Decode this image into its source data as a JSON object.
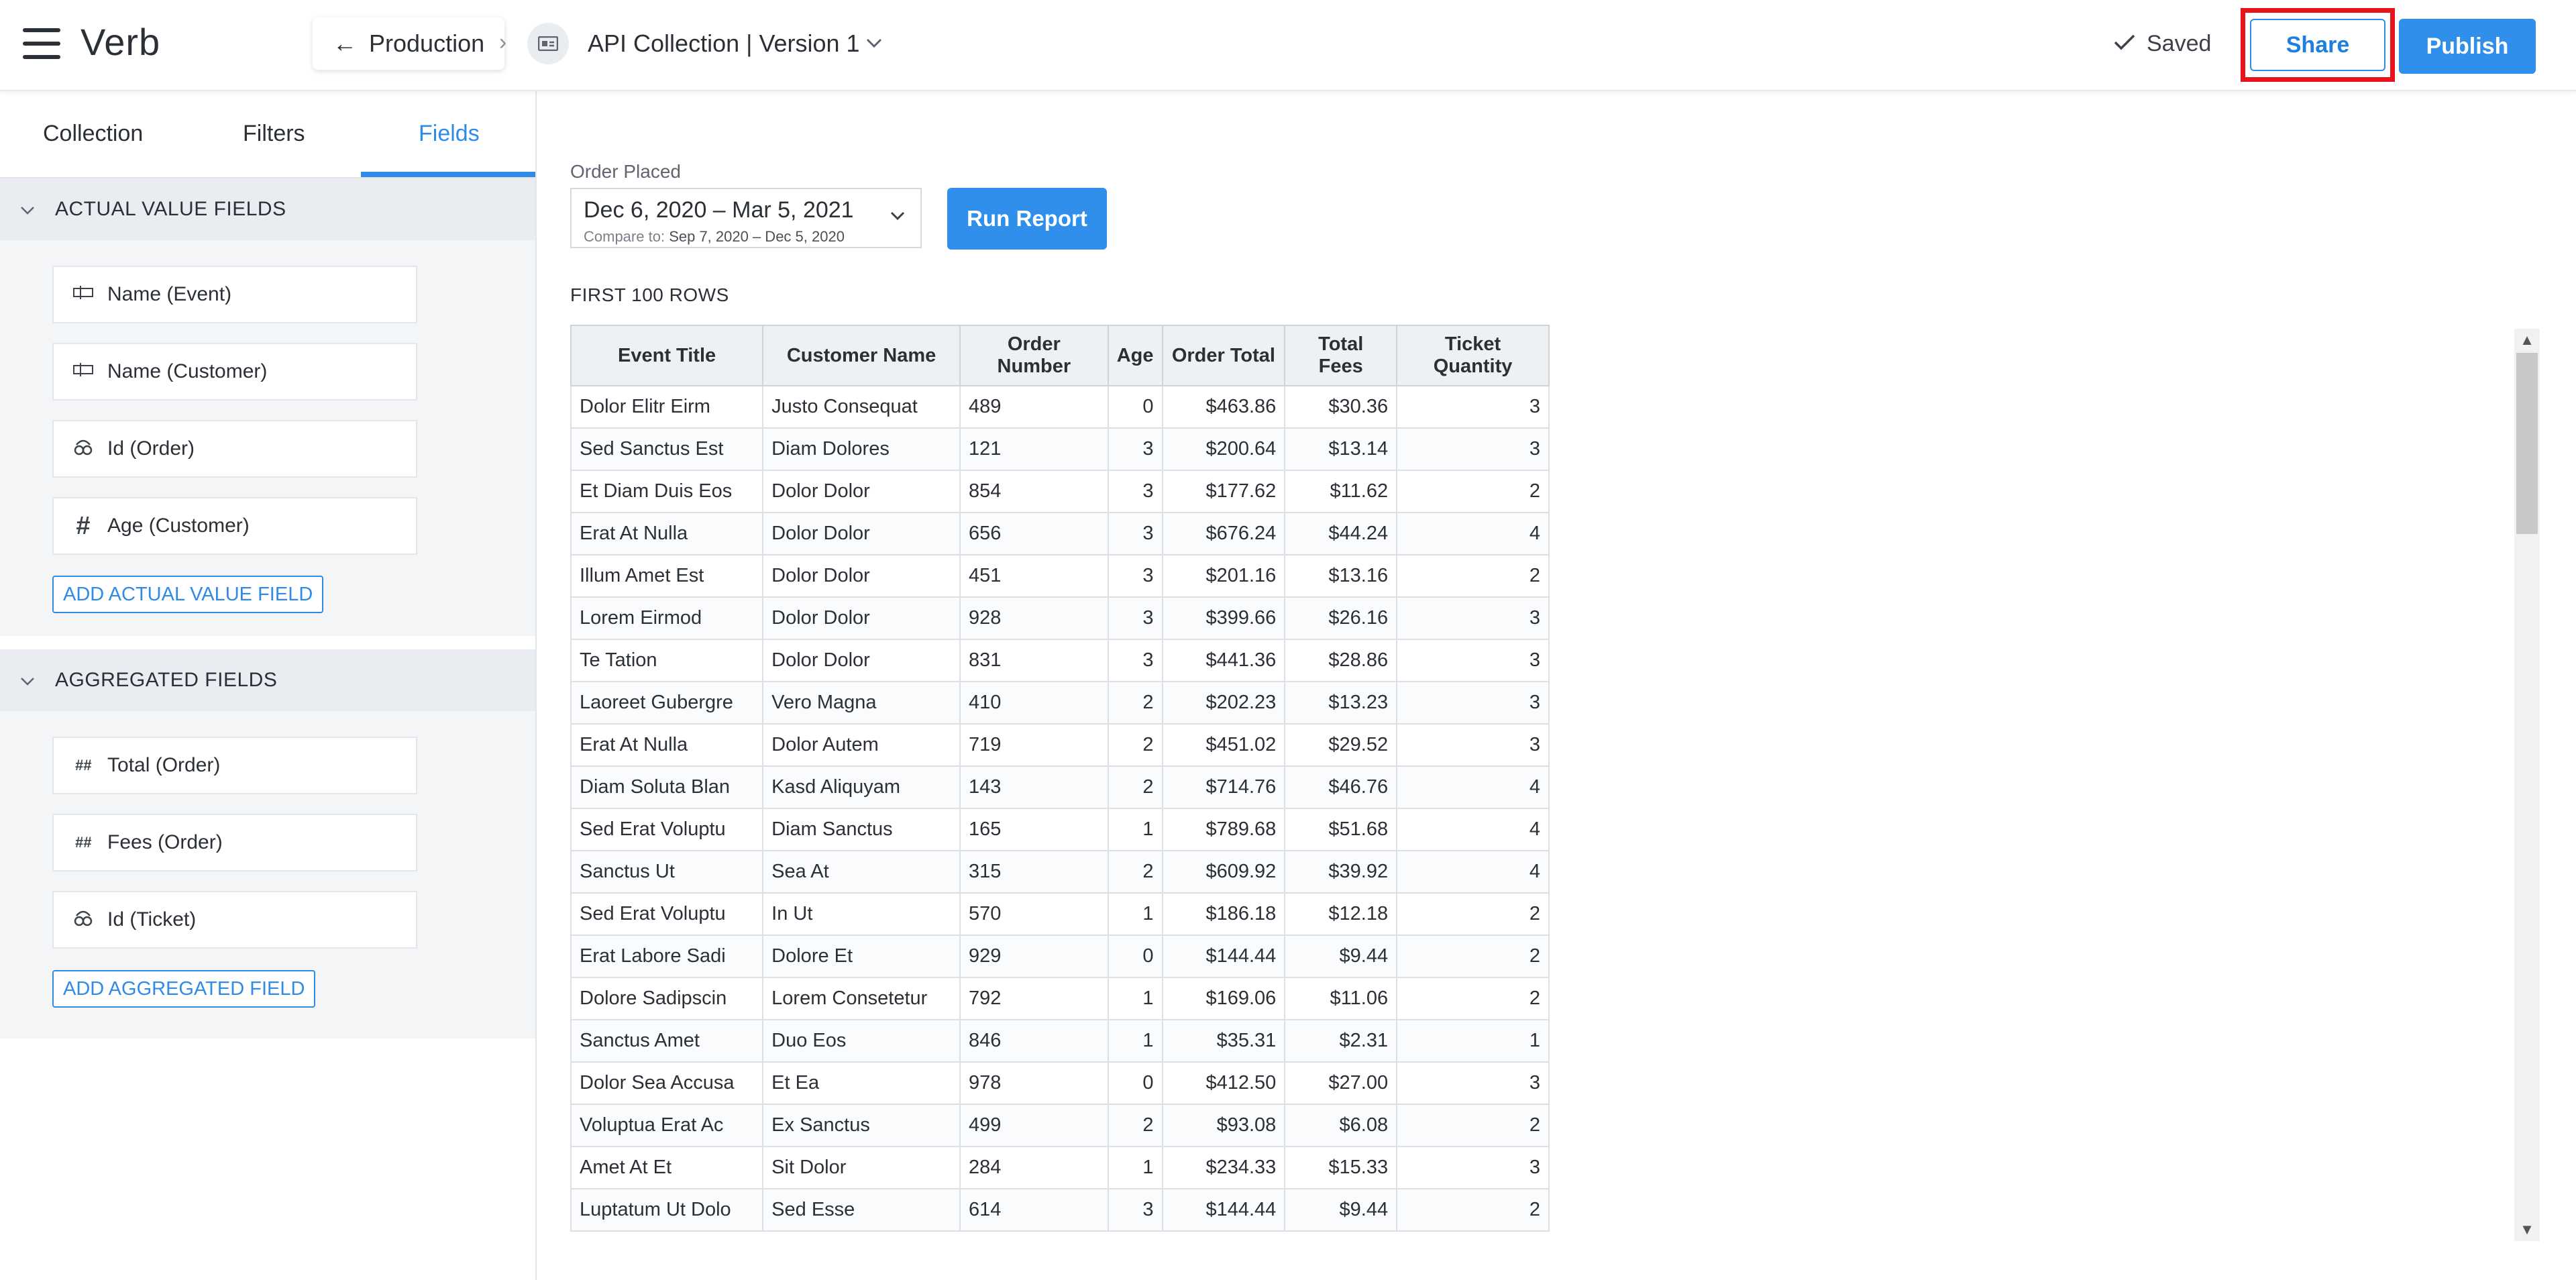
{
  "app": {
    "logo": "Verb"
  },
  "header": {
    "back_label": "Production",
    "separator": "›",
    "doc_title": "API Collection | Version 1",
    "saved_label": "Saved",
    "share_label": "Share",
    "publish_label": "Publish"
  },
  "sidebar": {
    "tabs": [
      {
        "label": "Collection"
      },
      {
        "label": "Filters"
      },
      {
        "label": "Fields",
        "active": true
      }
    ],
    "actual_section": {
      "title": "ACTUAL VALUE FIELDS",
      "fields": [
        {
          "label": "Name (Event)",
          "icon": "text-field-icon"
        },
        {
          "label": "Name (Customer)",
          "icon": "text-field-icon"
        },
        {
          "label": "Id (Order)",
          "icon": "id-icon"
        },
        {
          "label": "Age (Customer)",
          "icon": "hash-icon"
        }
      ],
      "add_label": "ADD ACTUAL VALUE FIELD"
    },
    "aggregated_section": {
      "title": "AGGREGATED FIELDS",
      "fields": [
        {
          "label": "Total (Order)",
          "icon": "sum-hash-icon"
        },
        {
          "label": "Fees (Order)",
          "icon": "sum-hash-icon"
        },
        {
          "label": "Id (Ticket)",
          "icon": "id-icon"
        }
      ],
      "add_label": "ADD AGGREGATED FIELD"
    }
  },
  "report": {
    "date_label": "Order Placed",
    "date_range": "Dec 6, 2020 – Mar 5, 2021",
    "compare_prefix": "Compare to:",
    "compare_range": "Sep 7, 2020 – Dec 5, 2020",
    "run_label": "Run Report",
    "rows_label": "FIRST 100 ROWS"
  },
  "table": {
    "headers": [
      "Event Title",
      "Customer Name",
      "Order Number",
      "Age",
      "Order Total",
      "Total Fees",
      "Ticket Quantity"
    ],
    "rows": [
      [
        "Dolor Elitr Eirm",
        "Justo Consequat",
        "489",
        "0",
        "$463.86",
        "$30.36",
        "3"
      ],
      [
        "Sed Sanctus Est",
        "Diam Dolores",
        "121",
        "3",
        "$200.64",
        "$13.14",
        "3"
      ],
      [
        "Et Diam Duis Eos",
        "Dolor Dolor",
        "854",
        "3",
        "$177.62",
        "$11.62",
        "2"
      ],
      [
        "Erat At Nulla",
        "Dolor Dolor",
        "656",
        "3",
        "$676.24",
        "$44.24",
        "4"
      ],
      [
        "Illum Amet Est",
        "Dolor Dolor",
        "451",
        "3",
        "$201.16",
        "$13.16",
        "2"
      ],
      [
        "Lorem Eirmod",
        "Dolor Dolor",
        "928",
        "3",
        "$399.66",
        "$26.16",
        "3"
      ],
      [
        "Te Tation",
        "Dolor Dolor",
        "831",
        "3",
        "$441.36",
        "$28.86",
        "3"
      ],
      [
        "Laoreet Gubergre",
        "Vero Magna",
        "410",
        "2",
        "$202.23",
        "$13.23",
        "3"
      ],
      [
        "Erat At Nulla",
        "Dolor Autem",
        "719",
        "2",
        "$451.02",
        "$29.52",
        "3"
      ],
      [
        "Diam Soluta Blan",
        "Kasd Aliquyam",
        "143",
        "2",
        "$714.76",
        "$46.76",
        "4"
      ],
      [
        "Sed Erat Voluptu",
        "Diam Sanctus",
        "165",
        "1",
        "$789.68",
        "$51.68",
        "4"
      ],
      [
        "Sanctus Ut",
        "Sea At",
        "315",
        "2",
        "$609.92",
        "$39.92",
        "4"
      ],
      [
        "Sed Erat Voluptu",
        "In Ut",
        "570",
        "1",
        "$186.18",
        "$12.18",
        "2"
      ],
      [
        "Erat Labore Sadi",
        "Dolore Et",
        "929",
        "0",
        "$144.44",
        "$9.44",
        "2"
      ],
      [
        "Dolore Sadipscin",
        "Lorem Consetetur",
        "792",
        "1",
        "$169.06",
        "$11.06",
        "2"
      ],
      [
        "Sanctus Amet",
        "Duo Eos",
        "846",
        "1",
        "$35.31",
        "$2.31",
        "1"
      ],
      [
        "Dolor Sea Accusa",
        "Et Ea",
        "978",
        "0",
        "$412.50",
        "$27.00",
        "3"
      ],
      [
        "Voluptua Erat Ac",
        "Ex Sanctus",
        "499",
        "2",
        "$93.08",
        "$6.08",
        "2"
      ],
      [
        "Amet At Et",
        "Sit Dolor",
        "284",
        "1",
        "$234.33",
        "$15.33",
        "3"
      ],
      [
        "Luptatum Ut Dolo",
        "Sed Esse",
        "614",
        "3",
        "$144.44",
        "$9.44",
        "2"
      ]
    ]
  },
  "colors": {
    "accent": "#2f8be6",
    "highlight": "#e8141b",
    "section_bg": "#e9edf1"
  }
}
